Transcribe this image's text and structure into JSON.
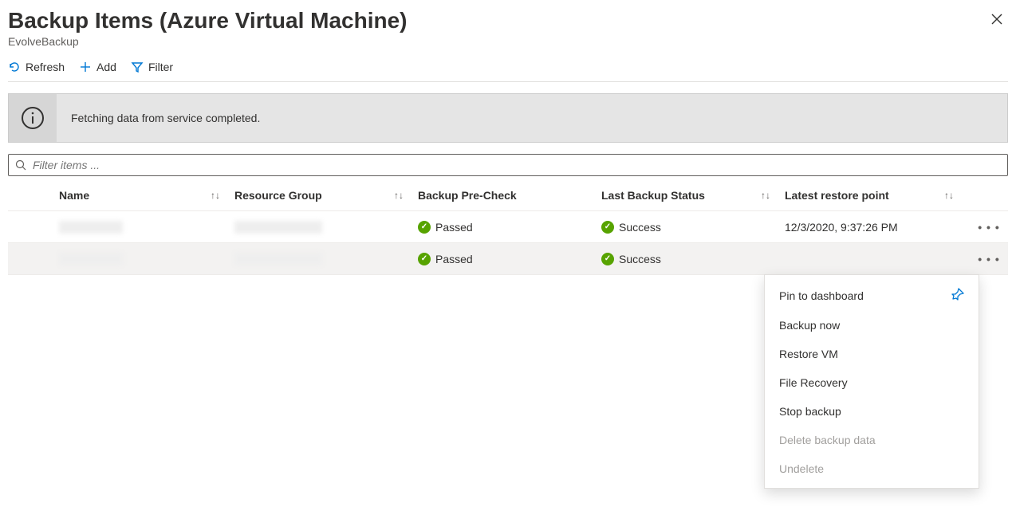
{
  "header": {
    "title": "Backup Items (Azure Virtual Machine)",
    "subtitle": "EvolveBackup"
  },
  "toolbar": {
    "refresh": "Refresh",
    "add": "Add",
    "filter": "Filter"
  },
  "banner": {
    "message": "Fetching data from service completed."
  },
  "search": {
    "placeholder": "Filter items ..."
  },
  "columns": {
    "name": "Name",
    "resource_group": "Resource Group",
    "precheck": "Backup Pre-Check",
    "last_status": "Last Backup Status",
    "restore_point": "Latest restore point"
  },
  "rows": [
    {
      "name": "",
      "resource_group": "",
      "precheck": "Passed",
      "last_status": "Success",
      "restore_point": "12/3/2020, 9:37:26 PM"
    },
    {
      "name": "",
      "resource_group": "",
      "precheck": "Passed",
      "last_status": "Success",
      "restore_point": ""
    }
  ],
  "menu": {
    "pin": "Pin to dashboard",
    "backup_now": "Backup now",
    "restore_vm": "Restore VM",
    "file_recovery": "File Recovery",
    "stop_backup": "Stop backup",
    "delete": "Delete backup data",
    "undelete": "Undelete"
  }
}
